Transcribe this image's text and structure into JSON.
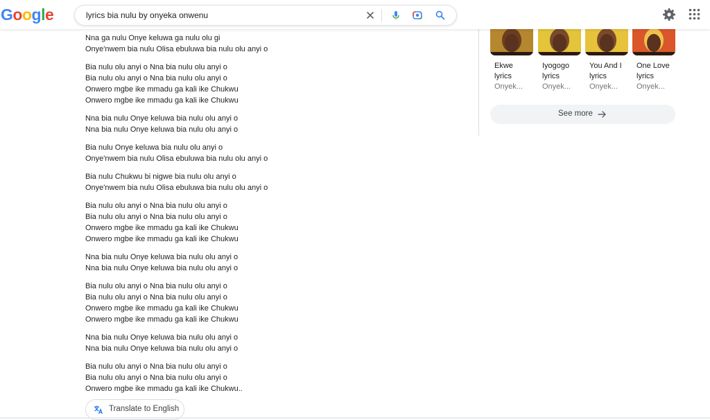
{
  "logo": {
    "letters": [
      "G",
      "o",
      "o",
      "g",
      "l",
      "e"
    ],
    "colors": [
      "#4285f4",
      "#ea4335",
      "#fbbc05",
      "#4285f4",
      "#34a853",
      "#ea4335"
    ]
  },
  "search": {
    "query": "lyrics bia nulu by onyeka onwenu"
  },
  "header_icons": [
    "close-icon",
    "mic-icon",
    "lens-icon",
    "search-icon",
    "settings-icon",
    "apps-icon"
  ],
  "lyrics": {
    "stanzas": [
      [
        "Nna ga nulu Onye keluwa ga nulu olu gi",
        "Onye'nwem bia nulu Olisa ebuluwa bia nulu olu anyi o"
      ],
      [
        "Bia nulu olu anyi o Nna bia nulu olu anyi o",
        "Bia nulu olu anyi o Nna bia nulu olu anyi o",
        "Onwero mgbe ike mmadu ga kali ike Chukwu",
        "Onwero mgbe ike mmadu ga kali ike Chukwu"
      ],
      [
        "Nna bia nulu Onye keluwa bia nulu olu anyi o",
        "Nna bia nulu Onye keluwa bia nulu olu anyi o"
      ],
      [
        "Bia nulu Onye keluwa bia nulu olu anyi o",
        "Onye'nwem bia nulu Olisa ebuluwa bia nulu olu anyi o"
      ],
      [
        "Bia nulu Chukwu bi nigwe bia nulu olu anyi o",
        "Onye'nwem bia nulu Olisa ebuluwa bia nulu olu anyi o"
      ],
      [
        "Bia nulu olu anyi o Nna bia nulu olu anyi o",
        "Bia nulu olu anyi o Nna bia nulu olu anyi o",
        "Onwero mgbe ike mmadu ga kali ike Chukwu",
        "Onwero mgbe ike mmadu ga kali ike Chukwu"
      ],
      [
        "Nna bia nulu Onye keluwa bia nulu olu anyi o",
        "Nna bia nulu Onye keluwa bia nulu olu anyi o"
      ],
      [
        "Bia nulu olu anyi o Nna bia nulu olu anyi o",
        "Bia nulu olu anyi o Nna bia nulu olu anyi o",
        "Onwero mgbe ike mmadu ga kali ike Chukwu",
        "Onwero mgbe ike mmadu ga kali ike Chukwu"
      ],
      [
        "Nna bia nulu Onye keluwa bia nulu olu anyi o",
        "Nna bia nulu Onye keluwa bia nulu olu anyi o"
      ],
      [
        "Bia nulu olu anyi o Nna bia nulu olu anyi o",
        "Bia nulu olu anyi o Nna bia nulu olu anyi o",
        "Onwero mgbe ike mmadu ga kali ike Chukwu.."
      ]
    ]
  },
  "translate": {
    "label": "Translate to English"
  },
  "other_songs": [
    {
      "title_line1": "Ekwe",
      "title_line2": "lyrics",
      "artist": "Onyek...",
      "bg": "#b5872f",
      "accent": "#6b3f1e"
    },
    {
      "title_line1": "Iyogogo",
      "title_line2": "lyrics",
      "artist": "Onyek...",
      "bg": "#e3c43a",
      "accent": "#7a4a2a"
    },
    {
      "title_line1": "You And I",
      "title_line2": "lyrics",
      "artist": "Onyek...",
      "bg": "#e7c23b",
      "accent": "#7a4a2a"
    },
    {
      "title_line1": "One Love",
      "title_line2": "lyrics",
      "artist": "Onyek...",
      "bg": "#d9572a",
      "accent": "#f0c24a"
    }
  ],
  "see_more": {
    "label": "See more"
  }
}
